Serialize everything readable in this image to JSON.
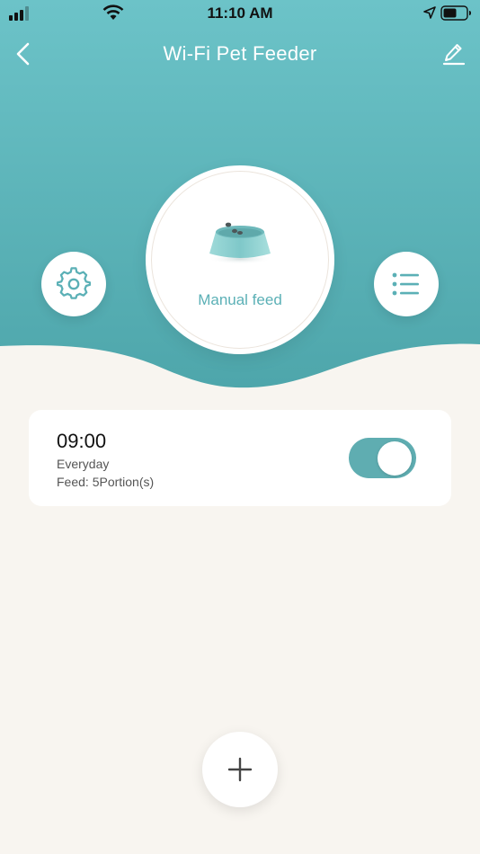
{
  "status_bar": {
    "time": "11:10 AM",
    "signal_icon": "cell-signal-icon",
    "wifi_icon": "wifi-icon",
    "location_icon": "location-arrow-icon",
    "battery_icon": "battery-icon"
  },
  "nav": {
    "title": "Wi-Fi Pet Feeder",
    "back_icon": "chevron-left-icon",
    "edit_icon": "pencil-icon"
  },
  "controls": {
    "manual_feed_label": "Manual feed",
    "settings_icon": "gear-icon",
    "list_icon": "list-icon",
    "bowl_icon": "pet-bowl-icon"
  },
  "schedules": [
    {
      "time": "09:00",
      "repeat": "Everyday",
      "portion": "Feed: 5Portion(s)",
      "enabled": true
    }
  ],
  "add_icon": "plus-icon",
  "colors": {
    "teal_top": "#6cc3c8",
    "teal_bottom": "#4fa8ad",
    "accent": "#5fadb1",
    "background": "#f8f5f0"
  }
}
